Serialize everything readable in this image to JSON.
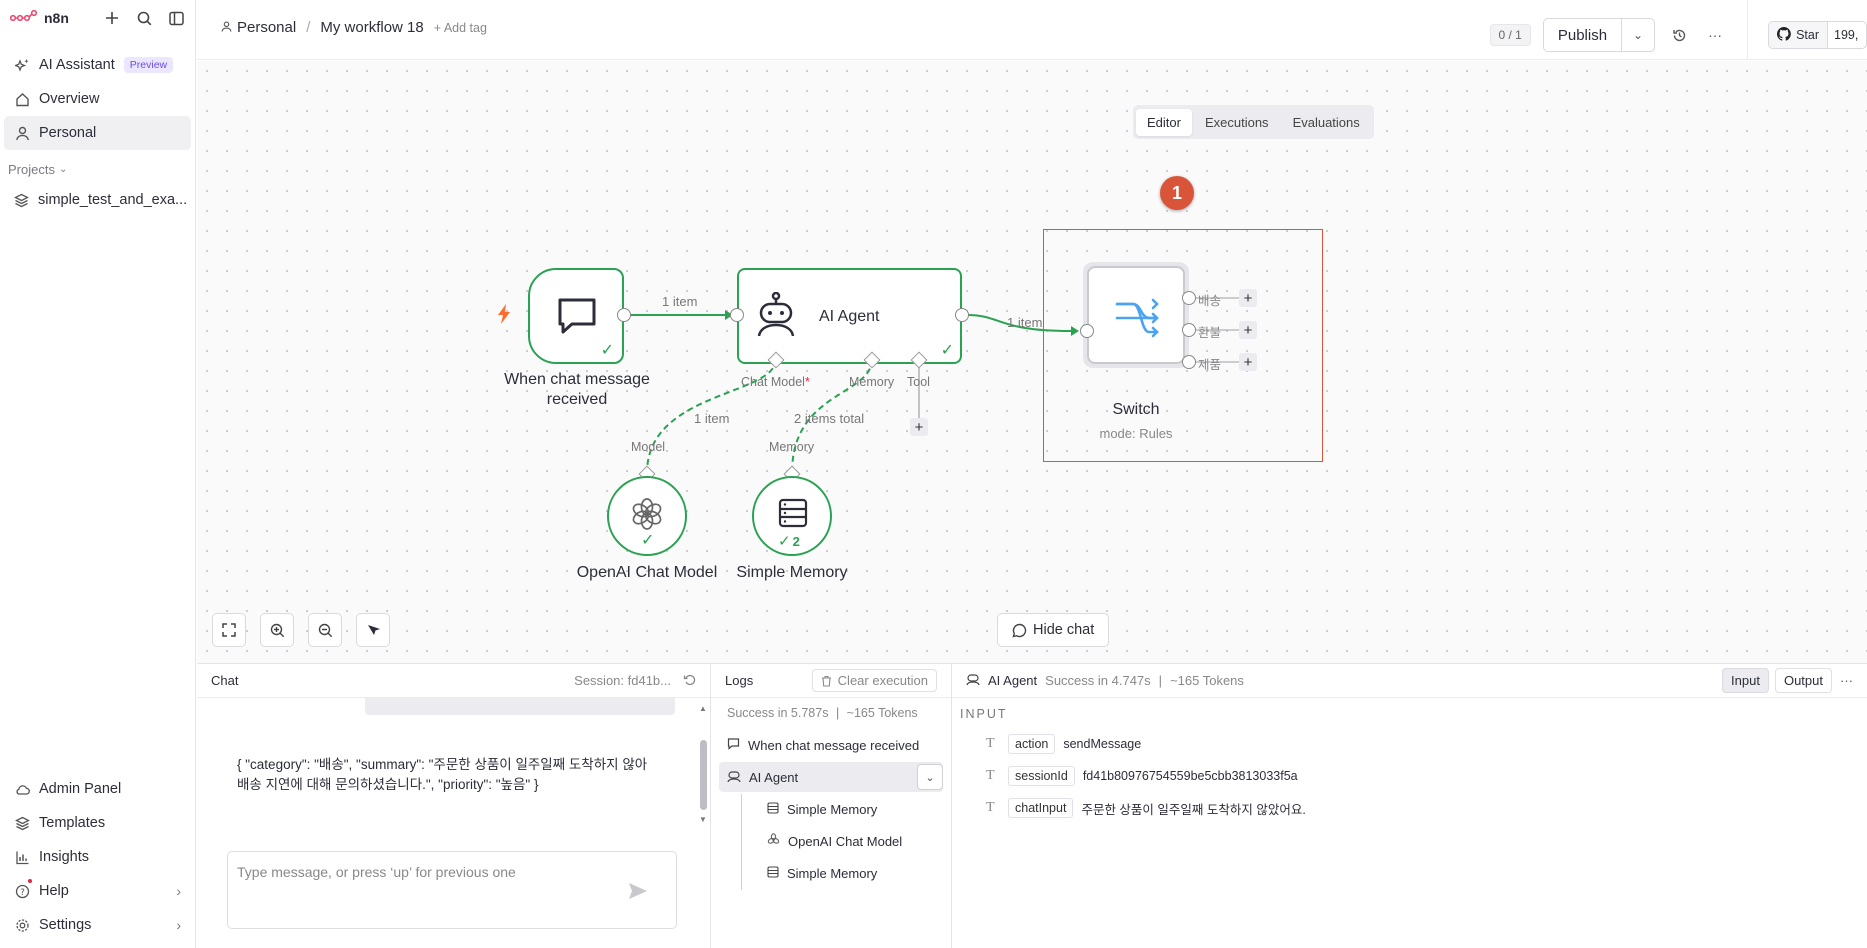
{
  "app": {
    "logo_text": "n8n"
  },
  "sidebar": {
    "items": [
      {
        "label": "AI Assistant",
        "badge": "Preview"
      },
      {
        "label": "Overview"
      },
      {
        "label": "Personal"
      }
    ],
    "projects_label": "Projects",
    "projects": [
      {
        "label": "simple_test_and_exa..."
      }
    ],
    "bottom": [
      {
        "label": "Admin Panel"
      },
      {
        "label": "Templates"
      },
      {
        "label": "Insights"
      },
      {
        "label": "Help"
      },
      {
        "label": "Settings"
      }
    ]
  },
  "header": {
    "breadcrumb_project": "Personal",
    "workflow_name": "My workflow 18",
    "add_tag": "+ Add tag",
    "counter": "0 / 1",
    "publish_label": "Publish",
    "github_star": "Star",
    "github_count": "199,"
  },
  "tabs": [
    "Editor",
    "Executions",
    "Evaluations"
  ],
  "canvas": {
    "nodes": {
      "trigger": {
        "label": "When chat message received"
      },
      "agent": {
        "label": "AI Agent",
        "ports": {
          "chat_model": "Chat Model",
          "memory": "Memory",
          "tool": "Tool"
        }
      },
      "openai": {
        "label": "OpenAI Chat Model",
        "port": "Model"
      },
      "memory": {
        "label": "Simple Memory",
        "port": "Memory",
        "run_count": "2"
      },
      "switch": {
        "label": "Switch",
        "subtitle": "mode: Rules",
        "outputs": [
          "배송",
          "환불",
          "제품"
        ]
      }
    },
    "edges": {
      "trigger_agent": "1 item",
      "agent_switch": "1 item",
      "model_agent": "1 item",
      "memory_agent": "2 items total"
    },
    "marker": "1",
    "hide_chat": "Hide chat"
  },
  "chat": {
    "title": "Chat",
    "session": "Session: fd41b...",
    "message": "{ \"category\": \"배송\", \"summary\": \"주문한 상품이 일주일째 도착하지 않아 배송 지연에 대해 문의하셨습니다.\", \"priority\": \"높음\" }",
    "placeholder": "Type message, or press ‘up’ for previous one"
  },
  "logs": {
    "title": "Logs",
    "clear": "Clear execution",
    "summary": "Success in 5.787s",
    "tokens": "~165 Tokens",
    "rows": [
      "When chat message received",
      "AI Agent",
      "Simple Memory",
      "OpenAI Chat Model",
      "Simple Memory"
    ]
  },
  "detail": {
    "node": "AI Agent",
    "status": "Success in 4.747s",
    "tokens": "~165 Tokens",
    "input_btn": "Input",
    "output_btn": "Output",
    "section": "INPUT",
    "fields": [
      {
        "key": "action",
        "value": "sendMessage"
      },
      {
        "key": "sessionId",
        "value": "fd41b80976754559be5cbb3813033f5a"
      },
      {
        "key": "chatInput",
        "value": "주문한 상품이 일주일째 도착하지 않았어요."
      }
    ]
  },
  "colors": {
    "success": "#2ba152",
    "highlight": "#d9553a",
    "brand": "#ea4b71",
    "switch_icon": "#4aa3f0"
  }
}
